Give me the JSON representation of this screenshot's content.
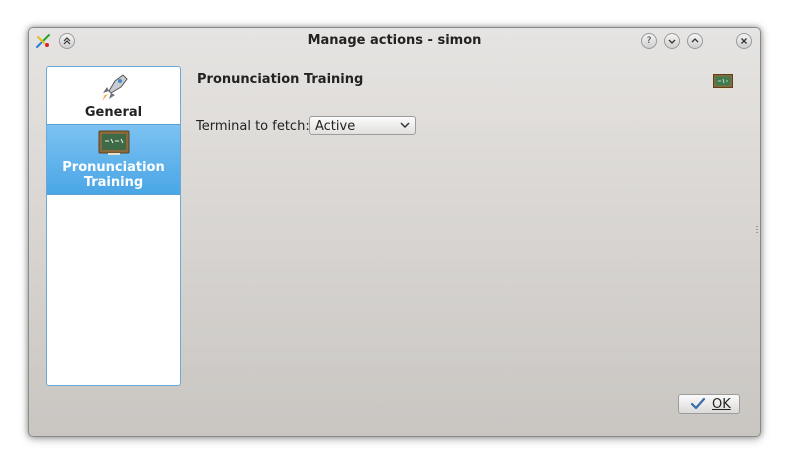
{
  "window": {
    "title": "Manage actions - simon"
  },
  "titlebar": {
    "icons": [
      "simon-app-icon",
      "keep-above-icon"
    ],
    "buttons": [
      "help-icon",
      "minimize-icon",
      "maximize-icon",
      "close-icon"
    ]
  },
  "sidebar": {
    "items": [
      {
        "label": "General",
        "icon": "rocket-icon",
        "selected": false
      },
      {
        "label": "Pronunciation Training",
        "icon": "chalkboard-icon",
        "selected": true
      }
    ]
  },
  "page": {
    "title": "Pronunciation Training",
    "icon": "chalkboard-icon"
  },
  "form": {
    "terminal_label": "Terminal to fetch:",
    "terminal_value": "Active"
  },
  "footer": {
    "ok_label": "OK"
  },
  "colors": {
    "selection": "#56ade9",
    "sidebar_border": "#6aa9d8"
  }
}
